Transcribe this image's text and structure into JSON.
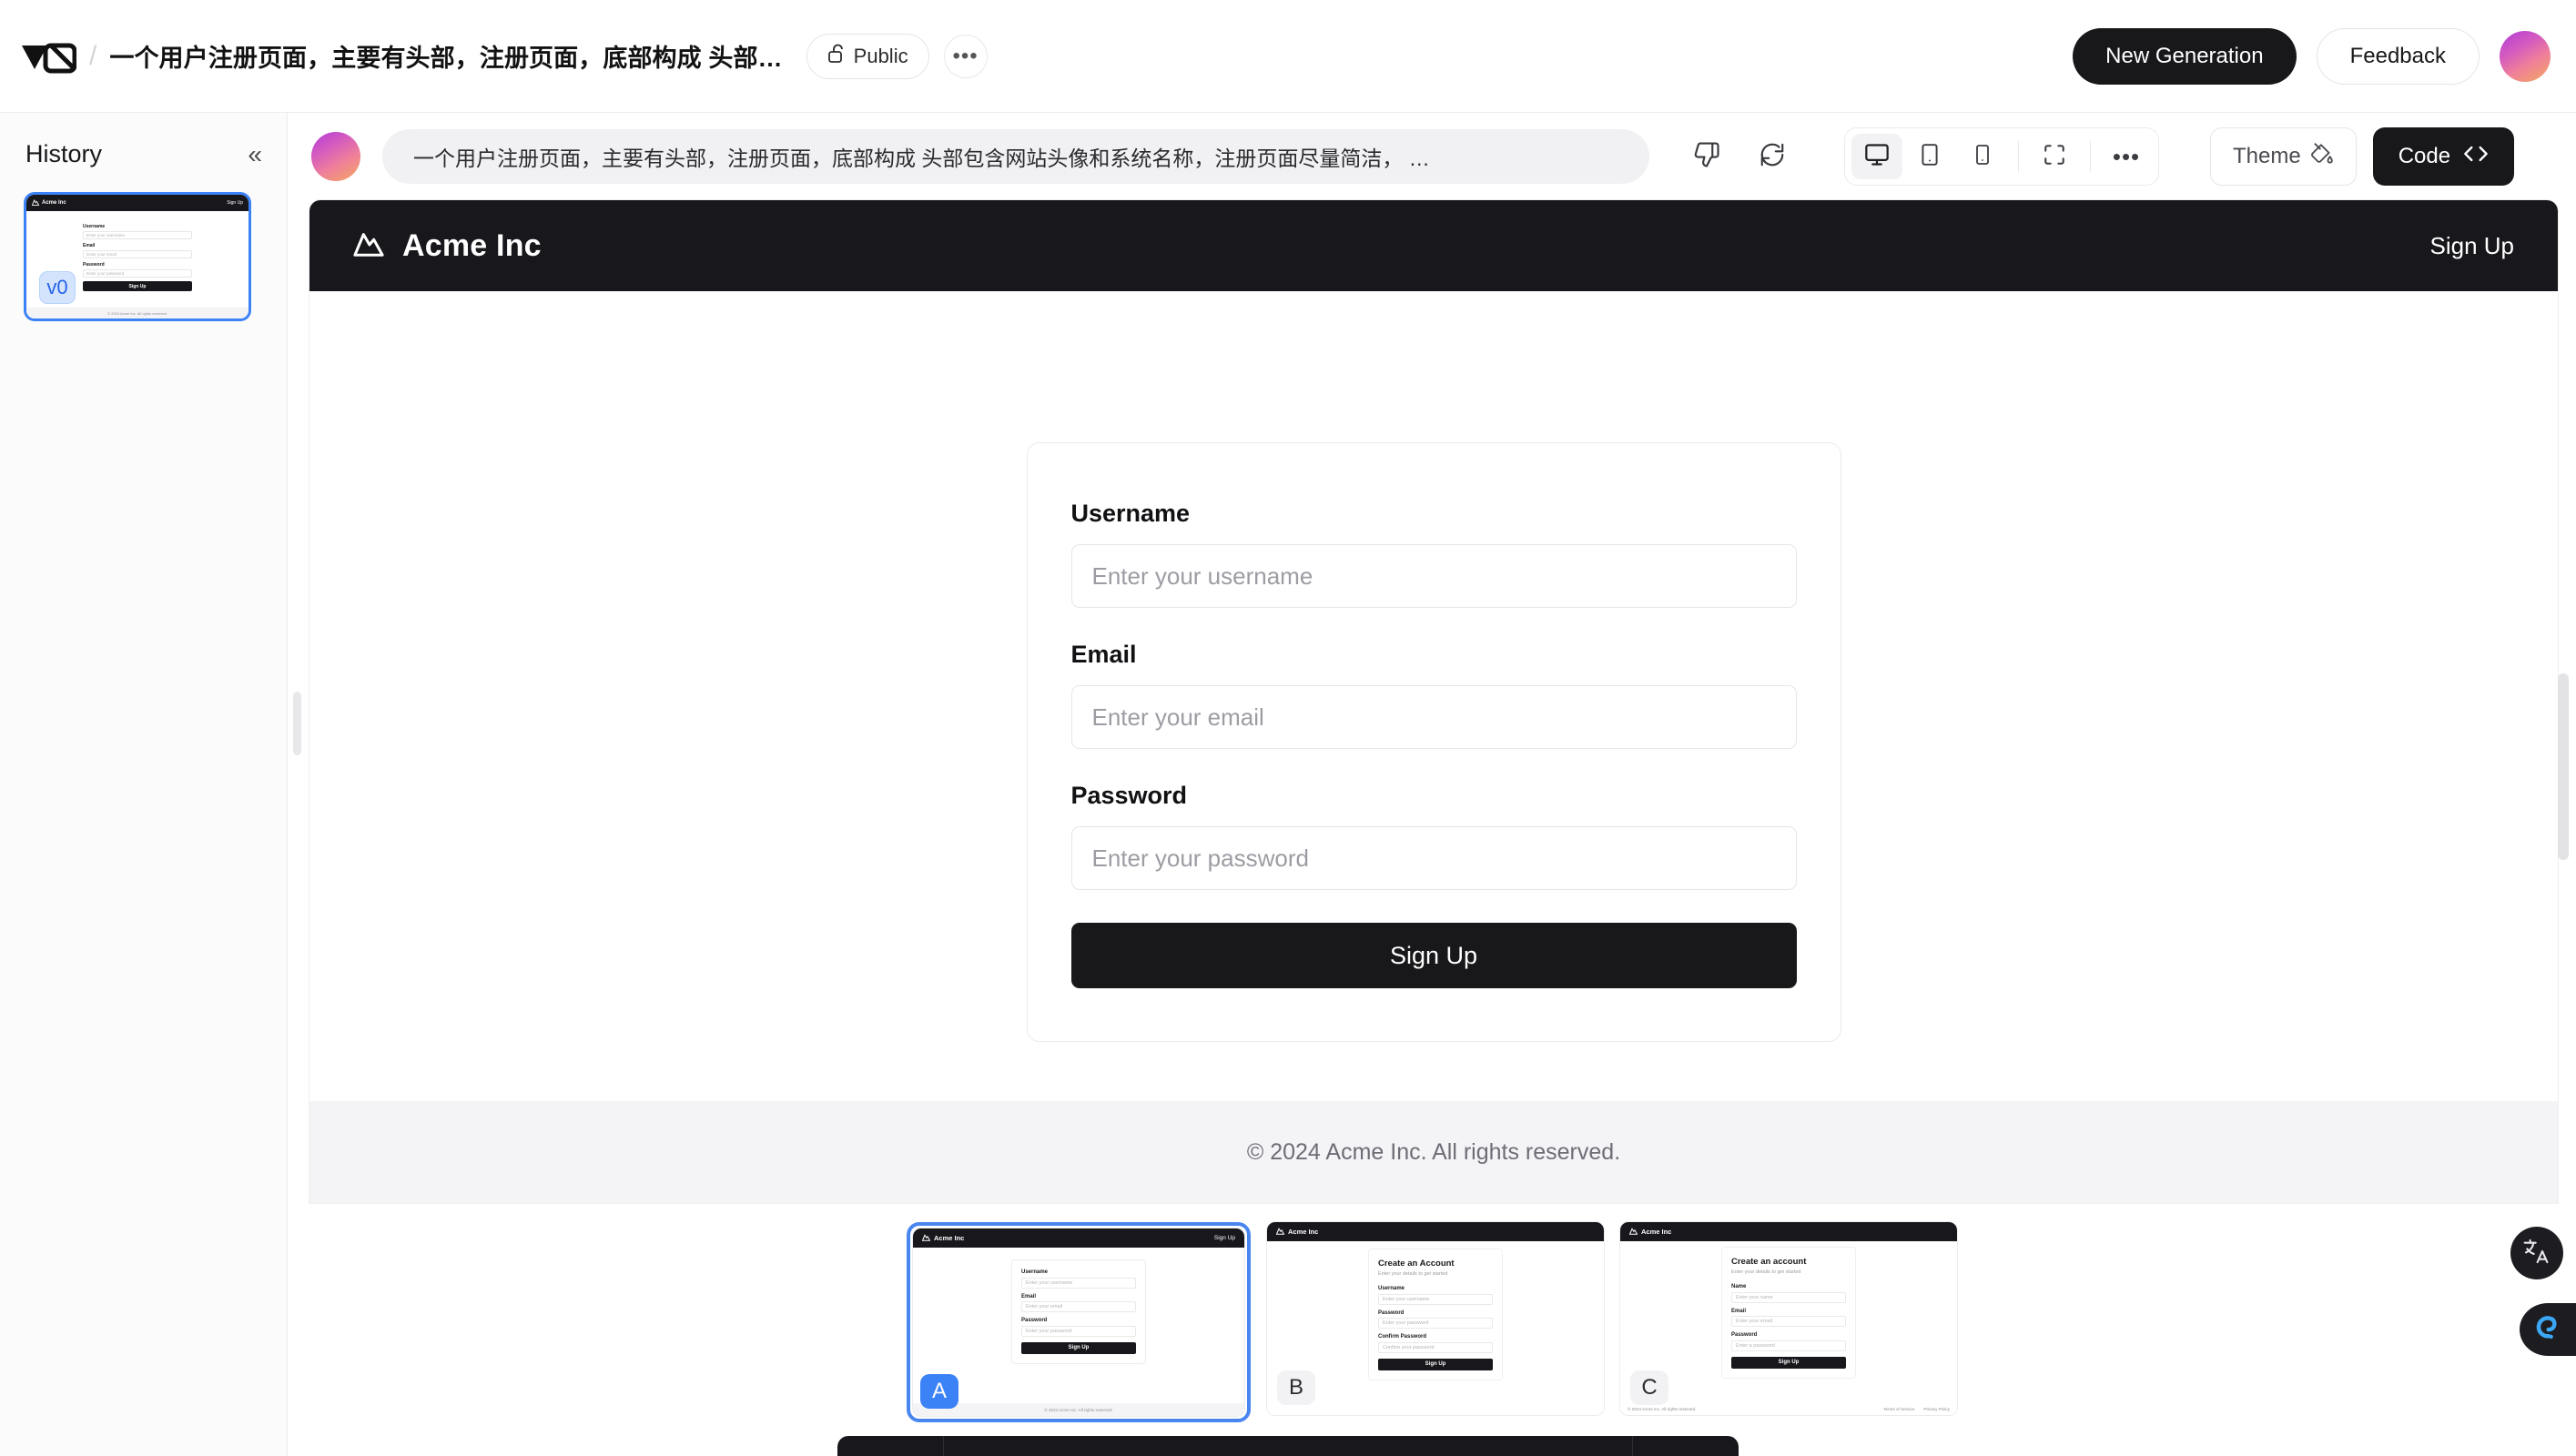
{
  "topbar": {
    "logo_icon": "v0-logo",
    "separator": "/",
    "project_title": "一个用户注册页面，主要有头部，注册页面，底部构成 头部…",
    "visibility_label": "Public",
    "visibility_icon": "lock-open-icon",
    "more_icon": "ellipsis-icon",
    "new_generation_label": "New Generation",
    "feedback_label": "Feedback",
    "avatar_icon": "user-avatar"
  },
  "sidebar": {
    "title": "History",
    "collapse_icon": "chevrons-left-icon",
    "items": [
      {
        "version_badge": "v0",
        "brand": "Acme Inc",
        "signup_link": "Sign Up",
        "fields": [
          {
            "label": "Username",
            "placeholder": "Enter your username"
          },
          {
            "label": "Email",
            "placeholder": "Enter your email"
          },
          {
            "label": "Password",
            "placeholder": "Enter your password"
          }
        ],
        "submit_label": "Sign Up",
        "footer": "© 2024 Acme Inc. All rights reserved."
      }
    ]
  },
  "promptbar": {
    "avatar_icon": "user-avatar",
    "prompt_text": "一个用户注册页面，主要有头部，注册页面，底部构成 头部包含网站头像和系统名称，注册页面尽量简洁， …",
    "thumbs_down_icon": "thumbs-down-icon",
    "refresh_icon": "refresh-icon",
    "viewports": [
      {
        "name": "desktop",
        "icon": "monitor-icon",
        "active": true
      },
      {
        "name": "tablet",
        "icon": "tablet-icon",
        "active": false
      },
      {
        "name": "mobile",
        "icon": "smartphone-icon",
        "active": false
      }
    ],
    "fullscreen_icon": "fullscreen-icon",
    "more_icon": "ellipsis-icon",
    "theme_label": "Theme",
    "theme_icon": "paint-bucket-icon",
    "code_label": "Code",
    "code_icon": "code-brackets-icon"
  },
  "preview": {
    "brand_icon": "mountain-icon",
    "brand_name": "Acme Inc",
    "nav_signup": "Sign Up",
    "form": {
      "fields": [
        {
          "label": "Username",
          "placeholder": "Enter your username",
          "value": ""
        },
        {
          "label": "Email",
          "placeholder": "Enter your email",
          "value": ""
        },
        {
          "label": "Password",
          "placeholder": "Enter your password",
          "value": ""
        }
      ],
      "submit_label": "Sign Up"
    },
    "footer": "© 2024 Acme Inc. All rights reserved."
  },
  "variants": [
    {
      "letter": "A",
      "selected": true,
      "brand": "Acme Inc",
      "nav_signup": "Sign Up",
      "title": "",
      "subtitle": "",
      "fields": [
        {
          "label": "Username",
          "placeholder": "Enter your username"
        },
        {
          "label": "Email",
          "placeholder": "Enter your email"
        },
        {
          "label": "Password",
          "placeholder": "Enter your password"
        }
      ],
      "submit_label": "Sign Up",
      "footer": "© 2024 Acme Inc. All rights reserved."
    },
    {
      "letter": "B",
      "selected": false,
      "brand": "Acme Inc",
      "nav_signup": "",
      "title": "Create an Account",
      "subtitle": "Enter your details to get started",
      "fields": [
        {
          "label": "Username",
          "placeholder": "Enter your username"
        },
        {
          "label": "Password",
          "placeholder": "Enter your password"
        },
        {
          "label": "Confirm Password",
          "placeholder": "Confirm your password"
        }
      ],
      "submit_label": "Sign Up",
      "footer": ""
    },
    {
      "letter": "C",
      "selected": false,
      "brand": "Acme Inc",
      "nav_signup": "",
      "title": "Create an account",
      "subtitle": "Enter your details to get started",
      "fields": [
        {
          "label": "Name",
          "placeholder": "Enter your name"
        },
        {
          "label": "Email",
          "placeholder": "Enter your email"
        },
        {
          "label": "Password",
          "placeholder": "Enter a password"
        }
      ],
      "submit_label": "Sign Up",
      "footer": "© 2024 Acme Inc. All rights reserved.",
      "footer_links": [
        "Terms of Service",
        "Privacy Policy"
      ]
    }
  ],
  "floating": {
    "translate_icon": "translate-icon",
    "chat_icon": "assistant-icon"
  },
  "colors": {
    "accent_dark": "#18181b",
    "selection_blue": "#3b82f6",
    "avatar_gradient_start": "#b13bd8",
    "avatar_gradient_end": "#f3a85f",
    "footer_bg": "#f4f4f7"
  }
}
